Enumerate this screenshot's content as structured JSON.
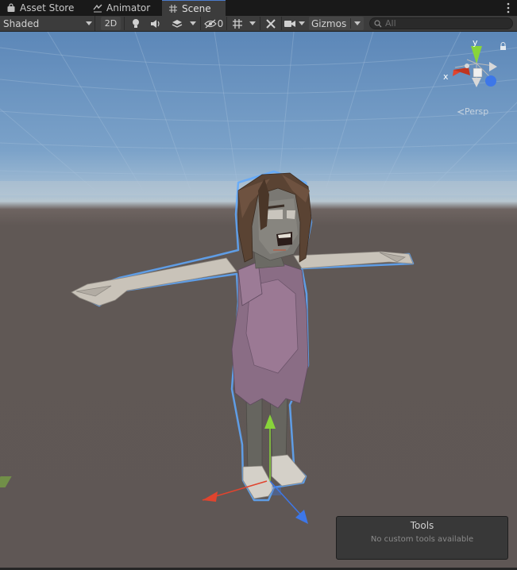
{
  "tabs": [
    {
      "label": "Asset Store",
      "icon": "shopping-bag-icon"
    },
    {
      "label": "Animator",
      "icon": "animator-icon"
    },
    {
      "label": "Scene",
      "icon": "grid-hash-icon",
      "active": true
    }
  ],
  "toolbar": {
    "shading_mode": "Shaded",
    "mode_2d": "2D",
    "hidden_count": "0",
    "gizmos_label": "Gizmos",
    "search_placeholder": "All"
  },
  "scene": {
    "projection_label": "Persp",
    "axis_labels": {
      "x": "x",
      "y": "y"
    }
  },
  "tools_overlay": {
    "title": "Tools",
    "subtitle": "No custom tools available"
  },
  "colors": {
    "accent": "#4b7ccc",
    "axis_x": "#e0442e",
    "axis_y": "#88d43a",
    "axis_z": "#3d77e8",
    "selection_outline": "#5fa9ff"
  }
}
